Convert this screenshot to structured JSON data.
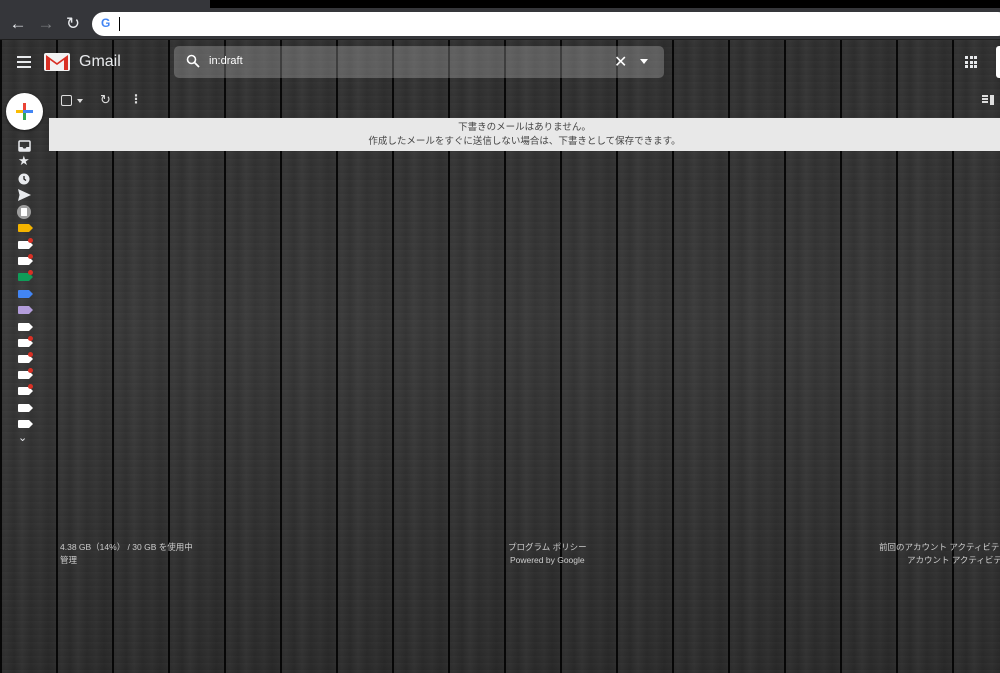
{
  "browser": {
    "back_icon": "arrow-left-icon",
    "forward_icon": "arrow-right-icon",
    "reload_icon": "reload-icon",
    "address_value": ""
  },
  "header": {
    "app_name": "Gmail",
    "search_value": "in:draft"
  },
  "empty_state": {
    "line1": "下書きのメールはありません。",
    "line2": "作成したメールをすぐに送信しない場合は、下書きとして保存できます。"
  },
  "footer": {
    "storage": "4.38 GB（14%） / 30 GB を使用中",
    "manage": "管理",
    "policy": "プログラム ポリシー",
    "powered": "Powered by Google",
    "last_activity": "前回のアカウント アクティビティ",
    "account_activity": "アカウント アクティビティ"
  },
  "colors": {
    "label_yellow": "#f4b400",
    "label_green": "#0f9d58",
    "label_blue": "#4285f4",
    "label_purple": "#b39ddb",
    "label_white": "#ffffff",
    "dot_red": "#d93025"
  }
}
